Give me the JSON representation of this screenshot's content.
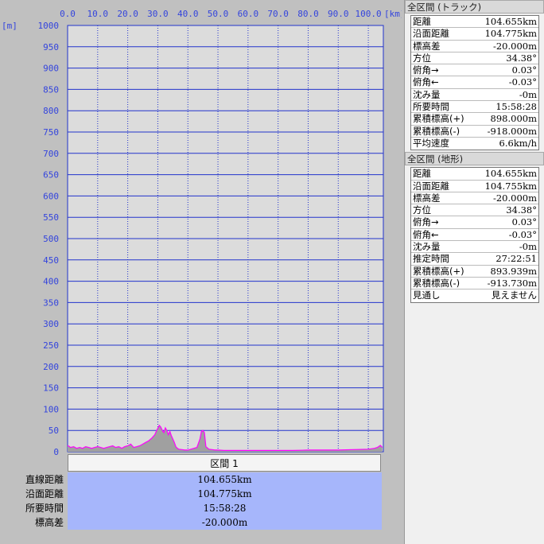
{
  "chart_data": {
    "type": "area",
    "xlabel": "[km]",
    "ylabel": "[m]",
    "xlim": [
      0,
      105
    ],
    "ylim": [
      0,
      1000
    ],
    "x_ticks": [
      "0.0",
      "10.0",
      "20.0",
      "30.0",
      "40.0",
      "50.0",
      "60.0",
      "70.0",
      "80.0",
      "90.0",
      "100.0"
    ],
    "y_ticks": [
      "0",
      "50",
      "100",
      "150",
      "200",
      "250",
      "300",
      "350",
      "400",
      "450",
      "500",
      "550",
      "600",
      "650",
      "700",
      "750",
      "800",
      "850",
      "900",
      "950",
      "1000"
    ],
    "grid": true,
    "series": [
      {
        "type": "area",
        "color": "#ff00ff",
        "fill": "#a0a0a0",
        "x": [
          0,
          1,
          2,
          3,
          4,
          5,
          6,
          7,
          8,
          9,
          10,
          11,
          12,
          13,
          14,
          15,
          16,
          17,
          18,
          19,
          20,
          21,
          22,
          23,
          24,
          25,
          26,
          27,
          28,
          29,
          29.5,
          30,
          30.5,
          31,
          31.5,
          32,
          32.5,
          33,
          33.5,
          34,
          34.5,
          35,
          35.5,
          36,
          36.5,
          37,
          38,
          39,
          40,
          41,
          42,
          43,
          44,
          44.5,
          45,
          45.5,
          46,
          47,
          48,
          49,
          50,
          52,
          55,
          60,
          65,
          70,
          75,
          80,
          85,
          90,
          95,
          100,
          102,
          103,
          104,
          104.655
        ],
        "y": [
          15,
          10,
          12,
          8,
          10,
          8,
          12,
          10,
          8,
          10,
          12,
          10,
          8,
          10,
          12,
          14,
          10,
          12,
          8,
          12,
          14,
          18,
          10,
          12,
          14,
          18,
          22,
          26,
          32,
          40,
          48,
          55,
          62,
          58,
          50,
          45,
          56,
          50,
          40,
          48,
          38,
          30,
          22,
          12,
          8,
          6,
          5,
          4,
          4,
          6,
          8,
          10,
          30,
          48,
          50,
          45,
          12,
          6,
          5,
          4,
          4,
          3,
          3,
          3,
          3,
          3,
          3,
          4,
          4,
          4,
          5,
          6,
          8,
          10,
          15,
          10
        ]
      }
    ]
  },
  "segment": {
    "button_label": "区間 1",
    "rows": [
      {
        "label": "直線距離",
        "value": "104.655km"
      },
      {
        "label": "沿面距離",
        "value": "104.775km"
      },
      {
        "label": "所要時間",
        "value": "15:58:28"
      },
      {
        "label": "標高差",
        "value": "-20.000m"
      }
    ]
  },
  "track_section": {
    "header": "全区間 (トラック)",
    "rows": [
      {
        "label": "距離",
        "value": "104.655km"
      },
      {
        "label": "沿面距離",
        "value": "104.775km"
      },
      {
        "label": "標高差",
        "value": "-20.000m"
      },
      {
        "label": "方位",
        "value": "34.38°"
      },
      {
        "label": "俯角→",
        "value": "0.03°"
      },
      {
        "label": "俯角←",
        "value": "-0.03°"
      },
      {
        "label": "沈み量",
        "value": "-0m"
      },
      {
        "label": "所要時間",
        "value": "15:58:28"
      },
      {
        "label": "累積標高(+)",
        "value": "898.000m"
      },
      {
        "label": "累積標高(-)",
        "value": "-918.000m"
      },
      {
        "label": "平均速度",
        "value": "6.6km/h"
      }
    ]
  },
  "terrain_section": {
    "header": "全区間 (地形)",
    "rows": [
      {
        "label": "距離",
        "value": "104.655km"
      },
      {
        "label": "沿面距離",
        "value": "104.755km"
      },
      {
        "label": "標高差",
        "value": "-20.000m"
      },
      {
        "label": "方位",
        "value": "34.38°"
      },
      {
        "label": "俯角→",
        "value": "0.03°"
      },
      {
        "label": "俯角←",
        "value": "-0.03°"
      },
      {
        "label": "沈み量",
        "value": "-0m"
      },
      {
        "label": "推定時間",
        "value": "27:22:51"
      },
      {
        "label": "累積標高(+)",
        "value": "893.939m"
      },
      {
        "label": "累積標高(-)",
        "value": "-913.730m"
      },
      {
        "label": "見通し",
        "value": "見えません"
      }
    ]
  }
}
